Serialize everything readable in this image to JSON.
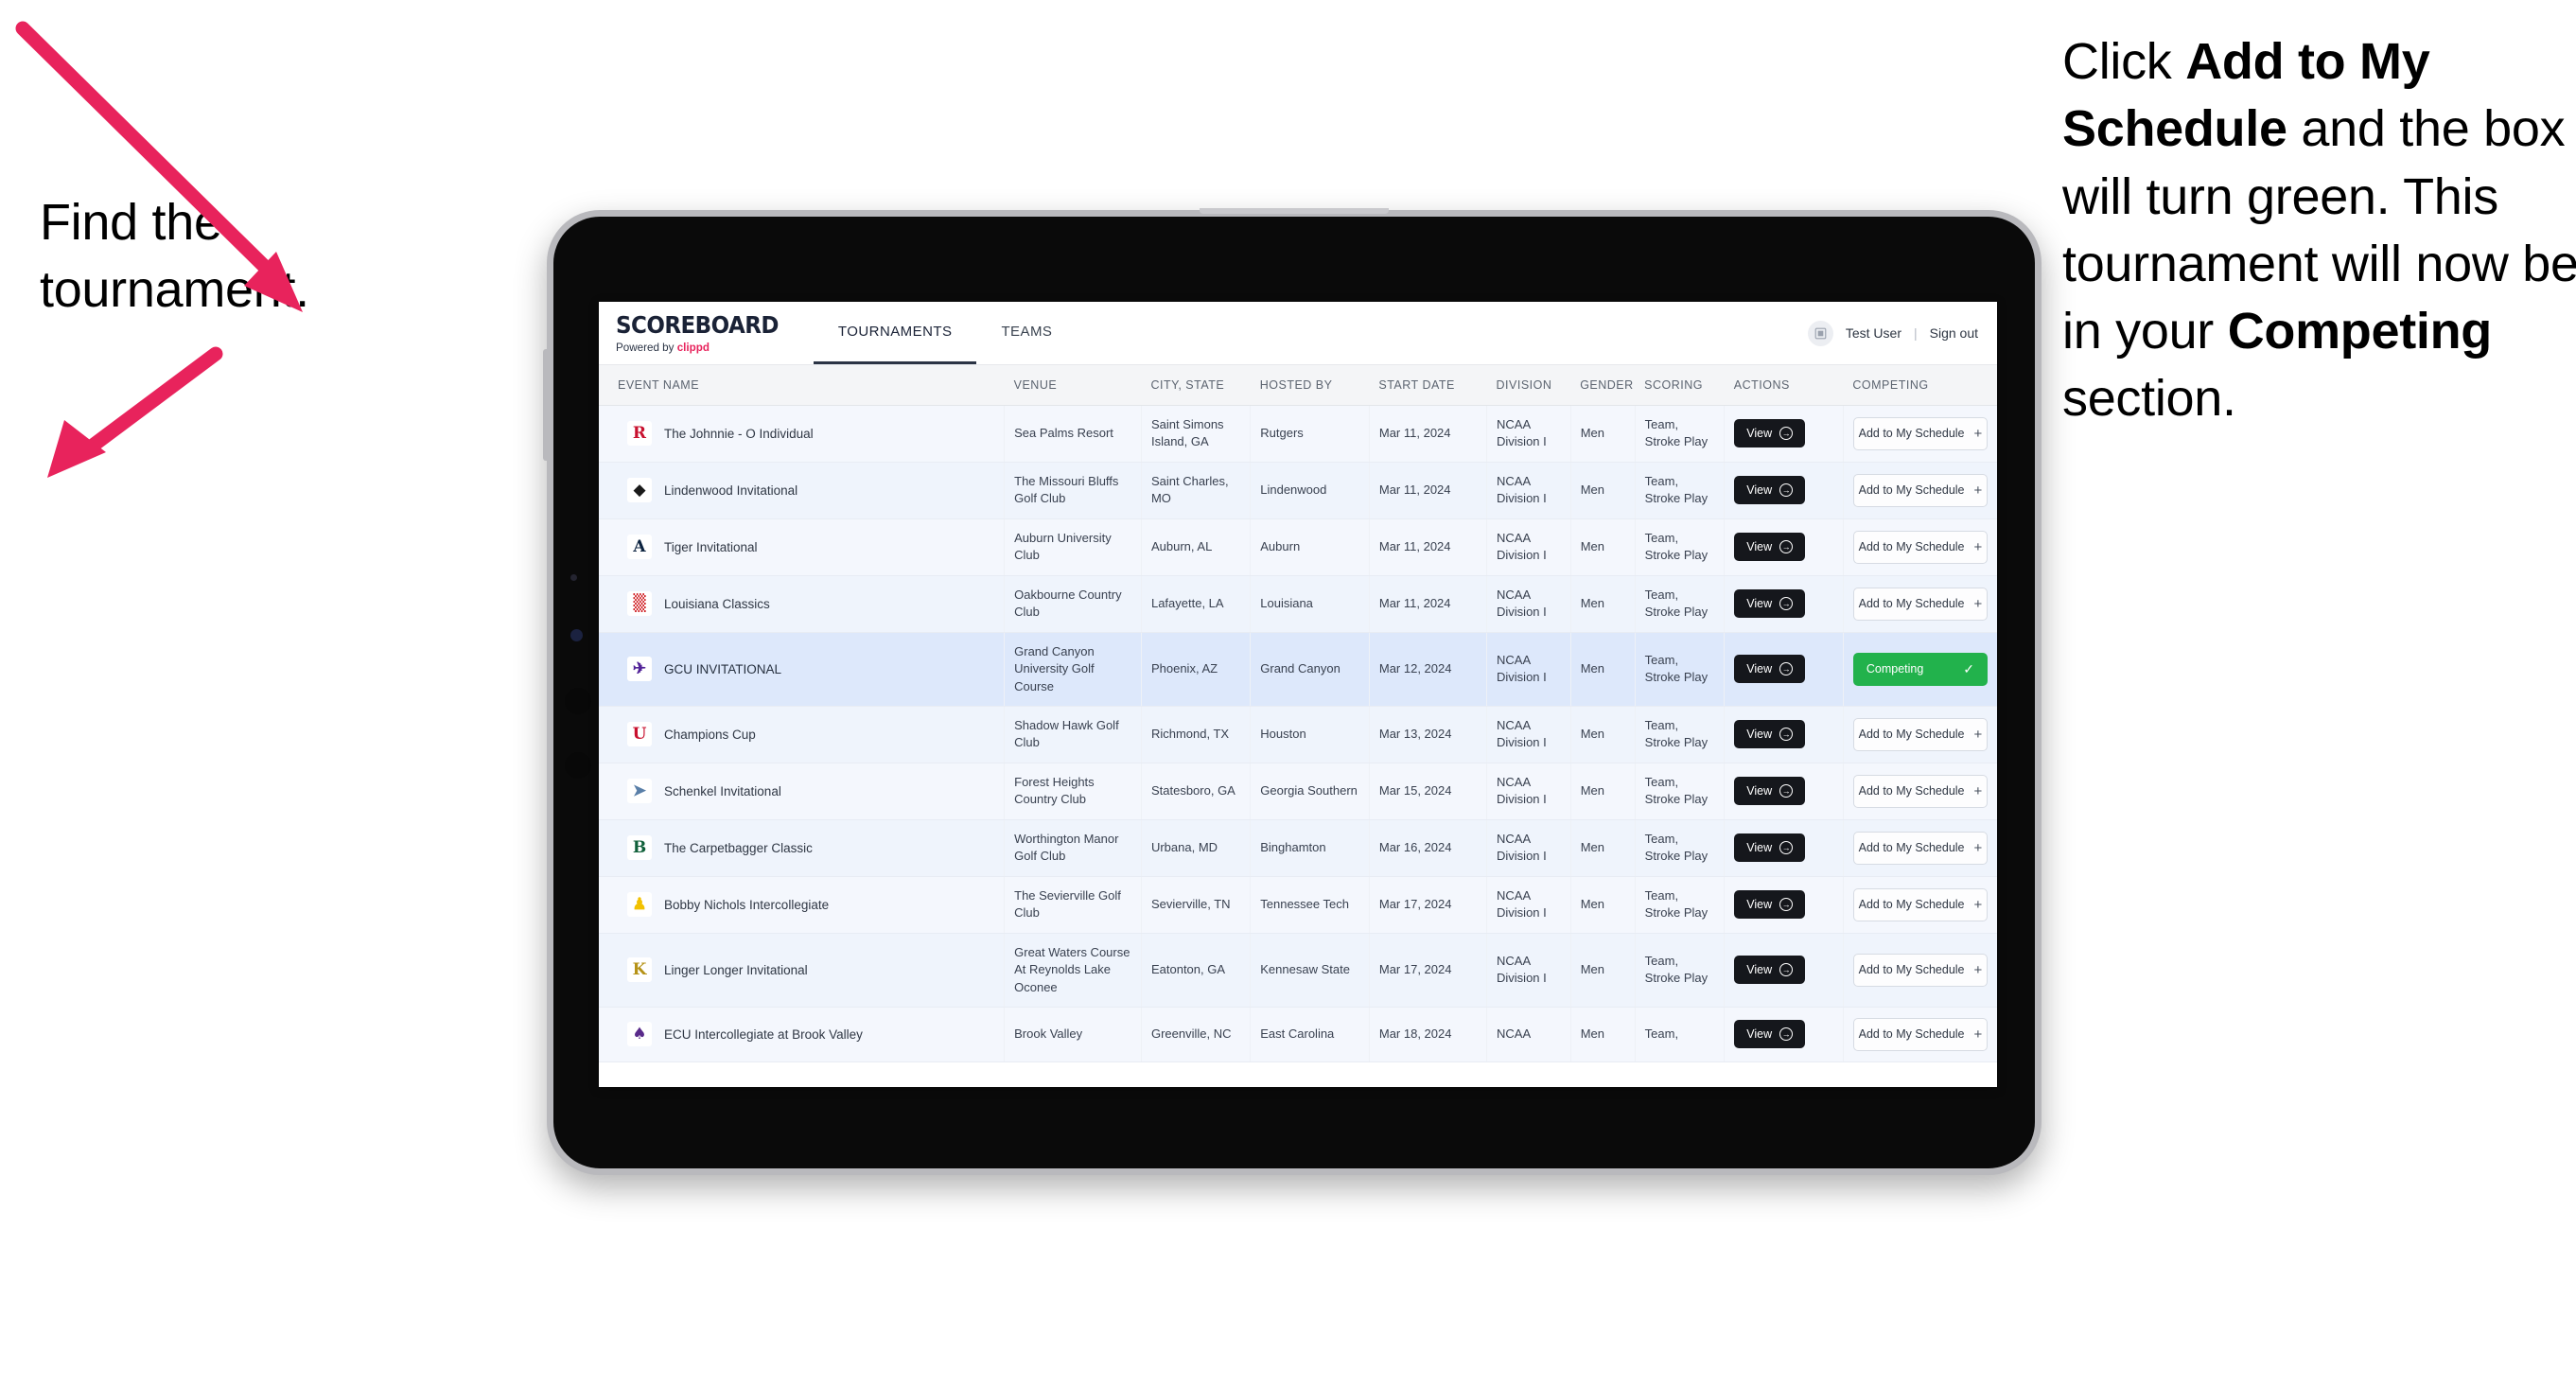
{
  "annotations": {
    "left": "Find the tournament.",
    "right_parts": [
      {
        "t": "Click ",
        "b": false
      },
      {
        "t": "Add to My Schedule",
        "b": true
      },
      {
        "t": " and the box will turn green. This tournament will now be in your ",
        "b": false
      },
      {
        "t": "Competing",
        "b": true
      },
      {
        "t": " section.",
        "b": false
      }
    ],
    "arrow_color": "#e8235c"
  },
  "app": {
    "brand": {
      "title": "SCOREBOARD",
      "powered_prefix": "Powered by ",
      "powered_brand": "clippd"
    },
    "nav": [
      {
        "label": "TOURNAMENTS",
        "active": true
      },
      {
        "label": "TEAMS",
        "active": false
      }
    ],
    "header_right": {
      "avatar_icon": "user-avatar-icon",
      "user_name": "Test User",
      "separator": "|",
      "sign_out": "Sign out"
    },
    "table": {
      "columns": [
        "EVENT NAME",
        "VENUE",
        "CITY, STATE",
        "HOSTED BY",
        "START DATE",
        "DIVISION",
        "GENDER",
        "SCORING",
        "ACTIONS",
        "COMPETING"
      ],
      "labels": {
        "view": "View",
        "add": "Add to My Schedule",
        "competing": "Competing",
        "plus": "+",
        "check": "✓",
        "view_arrow": "→"
      },
      "rows": [
        {
          "event": "The Johnnie - O Individual",
          "logo_text": "R",
          "logo_bg": "#ffffff",
          "logo_color": "#c8102e",
          "venue": "Sea Palms Resort",
          "city": "Saint Simons Island, GA",
          "host": "Rutgers",
          "date": "Mar 11, 2024",
          "division": "NCAA Division I",
          "gender": "Men",
          "scoring": "Team, Stroke Play",
          "competing": false
        },
        {
          "event": "Lindenwood Invitational",
          "logo_text": "◆",
          "logo_bg": "#ffffff",
          "logo_color": "#1a1a1a",
          "venue": "The Missouri Bluffs Golf Club",
          "city": "Saint Charles, MO",
          "host": "Lindenwood",
          "date": "Mar 11, 2024",
          "division": "NCAA Division I",
          "gender": "Men",
          "scoring": "Team, Stroke Play",
          "competing": false
        },
        {
          "event": "Tiger Invitational",
          "logo_text": "A",
          "logo_bg": "#ffffff",
          "logo_color": "#0c2340",
          "venue": "Auburn University Club",
          "city": "Auburn, AL",
          "host": "Auburn",
          "date": "Mar 11, 2024",
          "division": "NCAA Division I",
          "gender": "Men",
          "scoring": "Team, Stroke Play",
          "competing": false
        },
        {
          "event": "Louisiana Classics",
          "logo_text": "▒",
          "logo_bg": "#ffffff",
          "logo_color": "#ce181e",
          "venue": "Oakbourne Country Club",
          "city": "Lafayette, LA",
          "host": "Louisiana",
          "date": "Mar 11, 2024",
          "division": "NCAA Division I",
          "gender": "Men",
          "scoring": "Team, Stroke Play",
          "competing": false
        },
        {
          "event": "GCU INVITATIONAL",
          "logo_text": "✈",
          "logo_bg": "#ffffff",
          "logo_color": "#522398",
          "venue": "Grand Canyon University Golf Course",
          "city": "Phoenix, AZ",
          "host": "Grand Canyon",
          "date": "Mar 12, 2024",
          "division": "NCAA Division I",
          "gender": "Men",
          "scoring": "Team, Stroke Play",
          "competing": true
        },
        {
          "event": "Champions Cup",
          "logo_text": "U",
          "logo_bg": "#ffffff",
          "logo_color": "#c8102e",
          "venue": "Shadow Hawk Golf Club",
          "city": "Richmond, TX",
          "host": "Houston",
          "date": "Mar 13, 2024",
          "division": "NCAA Division I",
          "gender": "Men",
          "scoring": "Team, Stroke Play",
          "competing": false
        },
        {
          "event": "Schenkel Invitational",
          "logo_text": "➤",
          "logo_bg": "#ffffff",
          "logo_color": "#5a7fa8",
          "venue": "Forest Heights Country Club",
          "city": "Statesboro, GA",
          "host": "Georgia Southern",
          "date": "Mar 15, 2024",
          "division": "NCAA Division I",
          "gender": "Men",
          "scoring": "Team, Stroke Play",
          "competing": false
        },
        {
          "event": "The Carpetbagger Classic",
          "logo_text": "B",
          "logo_bg": "#ffffff",
          "logo_color": "#10603a",
          "venue": "Worthington Manor Golf Club",
          "city": "Urbana, MD",
          "host": "Binghamton",
          "date": "Mar 16, 2024",
          "division": "NCAA Division I",
          "gender": "Men",
          "scoring": "Team, Stroke Play",
          "competing": false
        },
        {
          "event": "Bobby Nichols Intercollegiate",
          "logo_text": "♟",
          "logo_bg": "#ffffff",
          "logo_color": "#f2c100",
          "venue": "The Sevierville Golf Club",
          "city": "Sevierville, TN",
          "host": "Tennessee Tech",
          "date": "Mar 17, 2024",
          "division": "NCAA Division I",
          "gender": "Men",
          "scoring": "Team, Stroke Play",
          "competing": false
        },
        {
          "event": "Linger Longer Invitational",
          "logo_text": "K",
          "logo_bg": "#ffffff",
          "logo_color": "#b59216",
          "venue": "Great Waters Course At Reynolds Lake Oconee",
          "city": "Eatonton, GA",
          "host": "Kennesaw State",
          "date": "Mar 17, 2024",
          "division": "NCAA Division I",
          "gender": "Men",
          "scoring": "Team, Stroke Play",
          "competing": false
        },
        {
          "event": "ECU Intercollegiate at Brook Valley",
          "logo_text": "♠",
          "logo_bg": "#ffffff",
          "logo_color": "#592a8a",
          "venue": "Brook Valley",
          "city": "Greenville, NC",
          "host": "East Carolina",
          "date": "Mar 18, 2024",
          "division": "NCAA",
          "gender": "Men",
          "scoring": "Team,",
          "competing": false
        }
      ]
    }
  }
}
